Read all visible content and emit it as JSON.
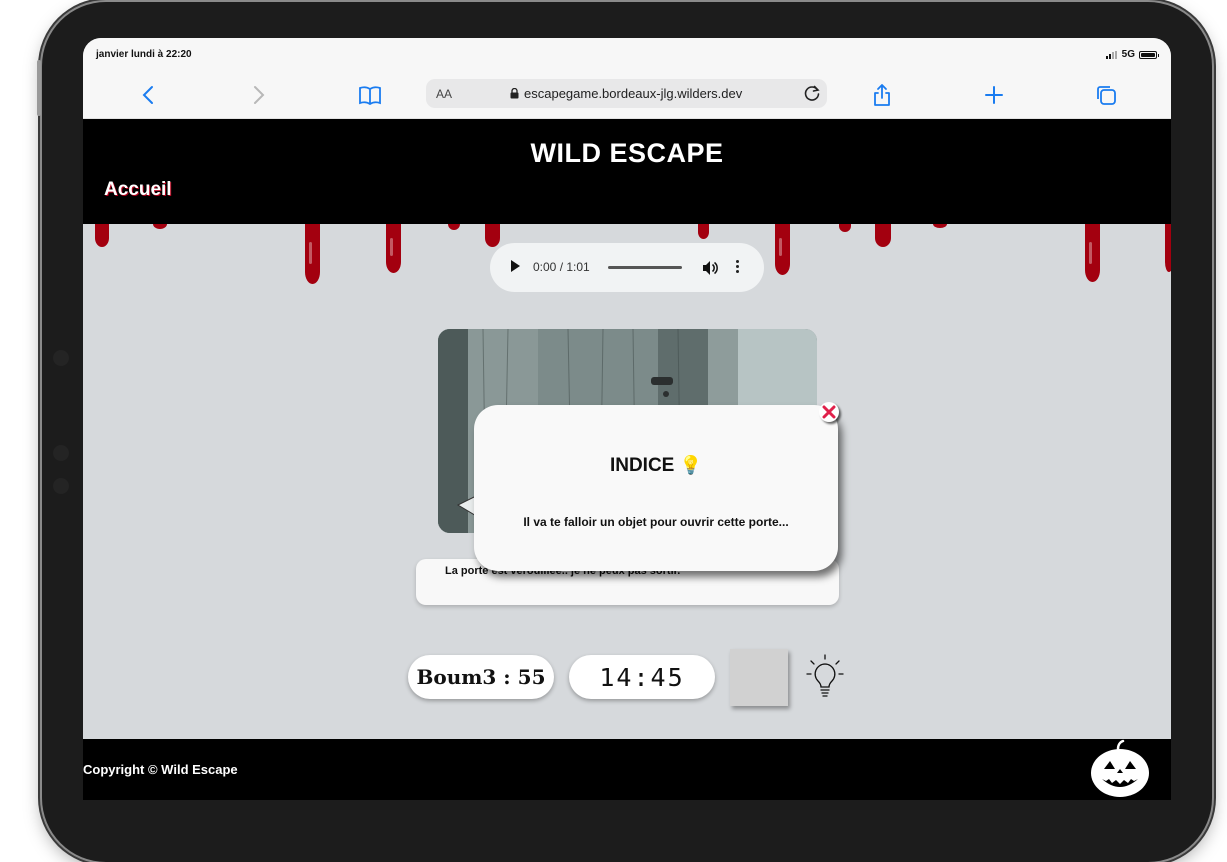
{
  "status": {
    "time": "janvier lundi à 22:20",
    "network": "5G"
  },
  "browser": {
    "text_size_label": "AA",
    "url": "escapegame.bordeaux-jlg.wilders.dev"
  },
  "site": {
    "title": "WILD ESCAPE",
    "nav_home": "Accueil"
  },
  "audio": {
    "time_display": "0:00 / 1:01"
  },
  "scene": {
    "narration": "La porte est verouillée.. je ne peux pas sortir."
  },
  "hint_modal": {
    "title": "INDICE",
    "emoji": "💡",
    "text": "Il va te falloir un objet pour ouvrir cette porte..."
  },
  "hud": {
    "player_score": "Boum3 : 55",
    "timer": "14:45"
  },
  "footer": {
    "copyright": "Copyright © Wild Escape"
  },
  "colors": {
    "blood": "#a3000f",
    "header_bg": "#000000",
    "page_bg": "#d6d9dc",
    "close_red": "#e0204a",
    "safari_blue": "#1a7cf0"
  }
}
